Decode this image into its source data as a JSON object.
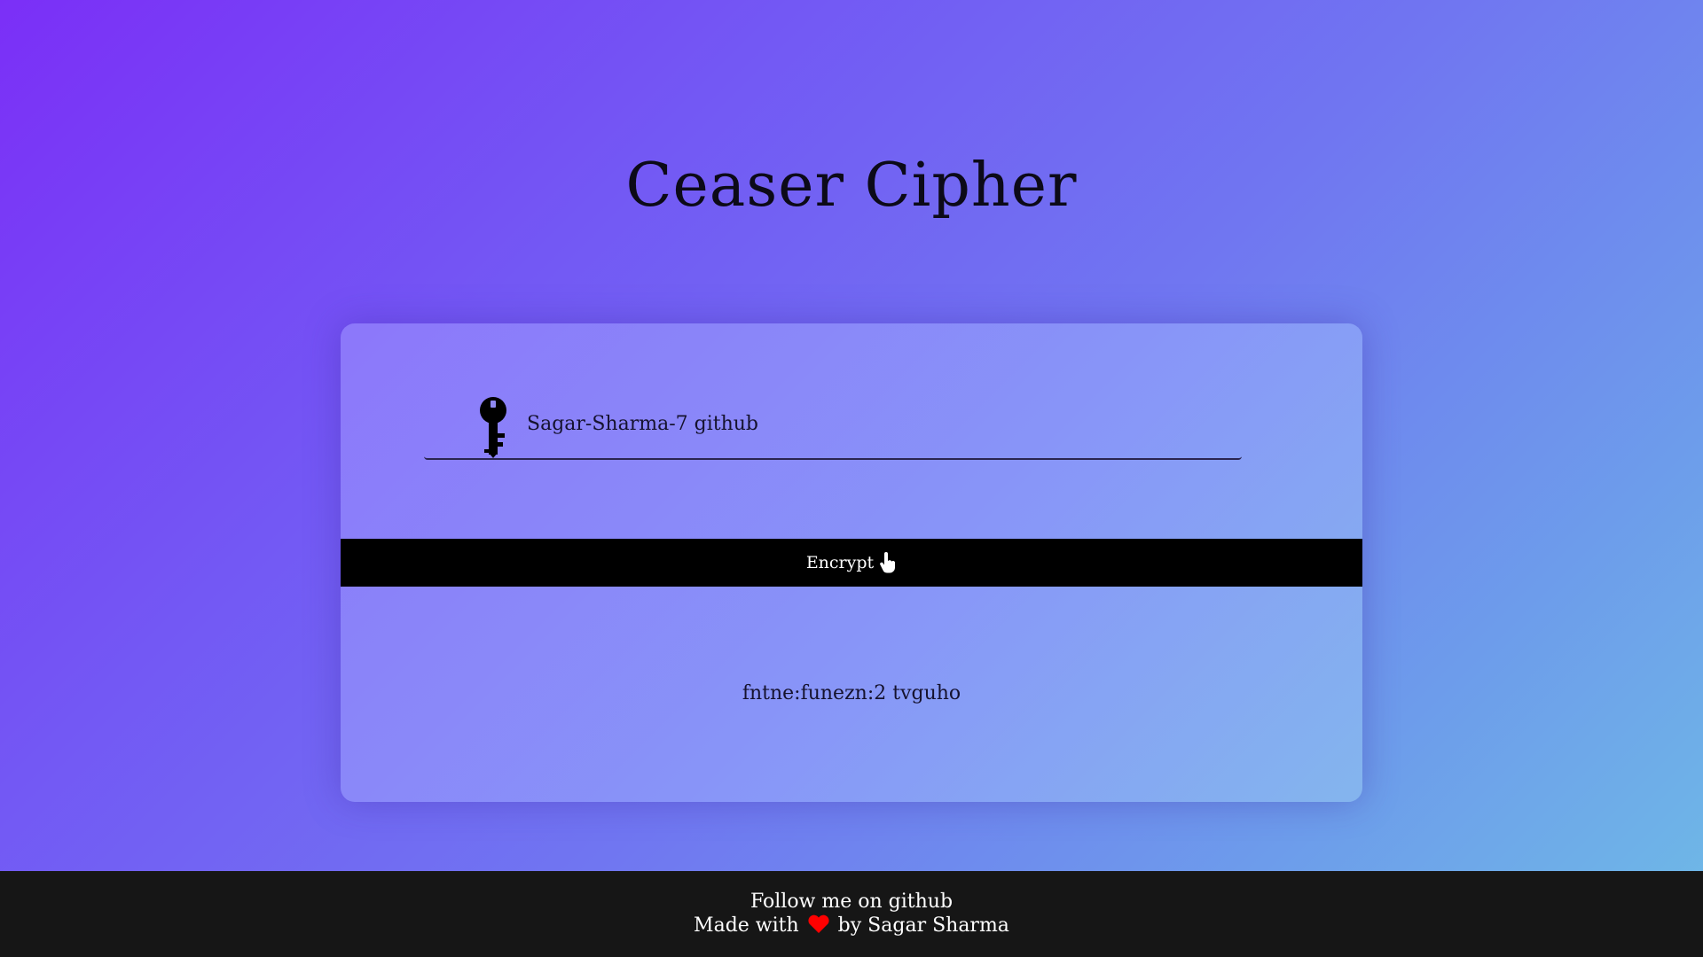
{
  "header": {
    "title": "Ceaser Cipher"
  },
  "form": {
    "key_icon": "key-icon",
    "input_value": "Sagar-Sharma-7 github",
    "encrypt_label": "Encrypt",
    "encrypt_icon": "pointing-hand-icon",
    "output_text": "fntne:funezn:2 tvguho"
  },
  "footer": {
    "follow_text": "Follow me on github",
    "made_with_prefix": "Made with",
    "heart_icon": "heart-icon",
    "made_with_suffix": "by Sagar Sharma"
  },
  "colors": {
    "gradient_start": "#7b2ff7",
    "gradient_end": "#6fbbe6",
    "button_bg": "#000000",
    "footer_bg": "#161616",
    "heart": "#ff0000"
  }
}
